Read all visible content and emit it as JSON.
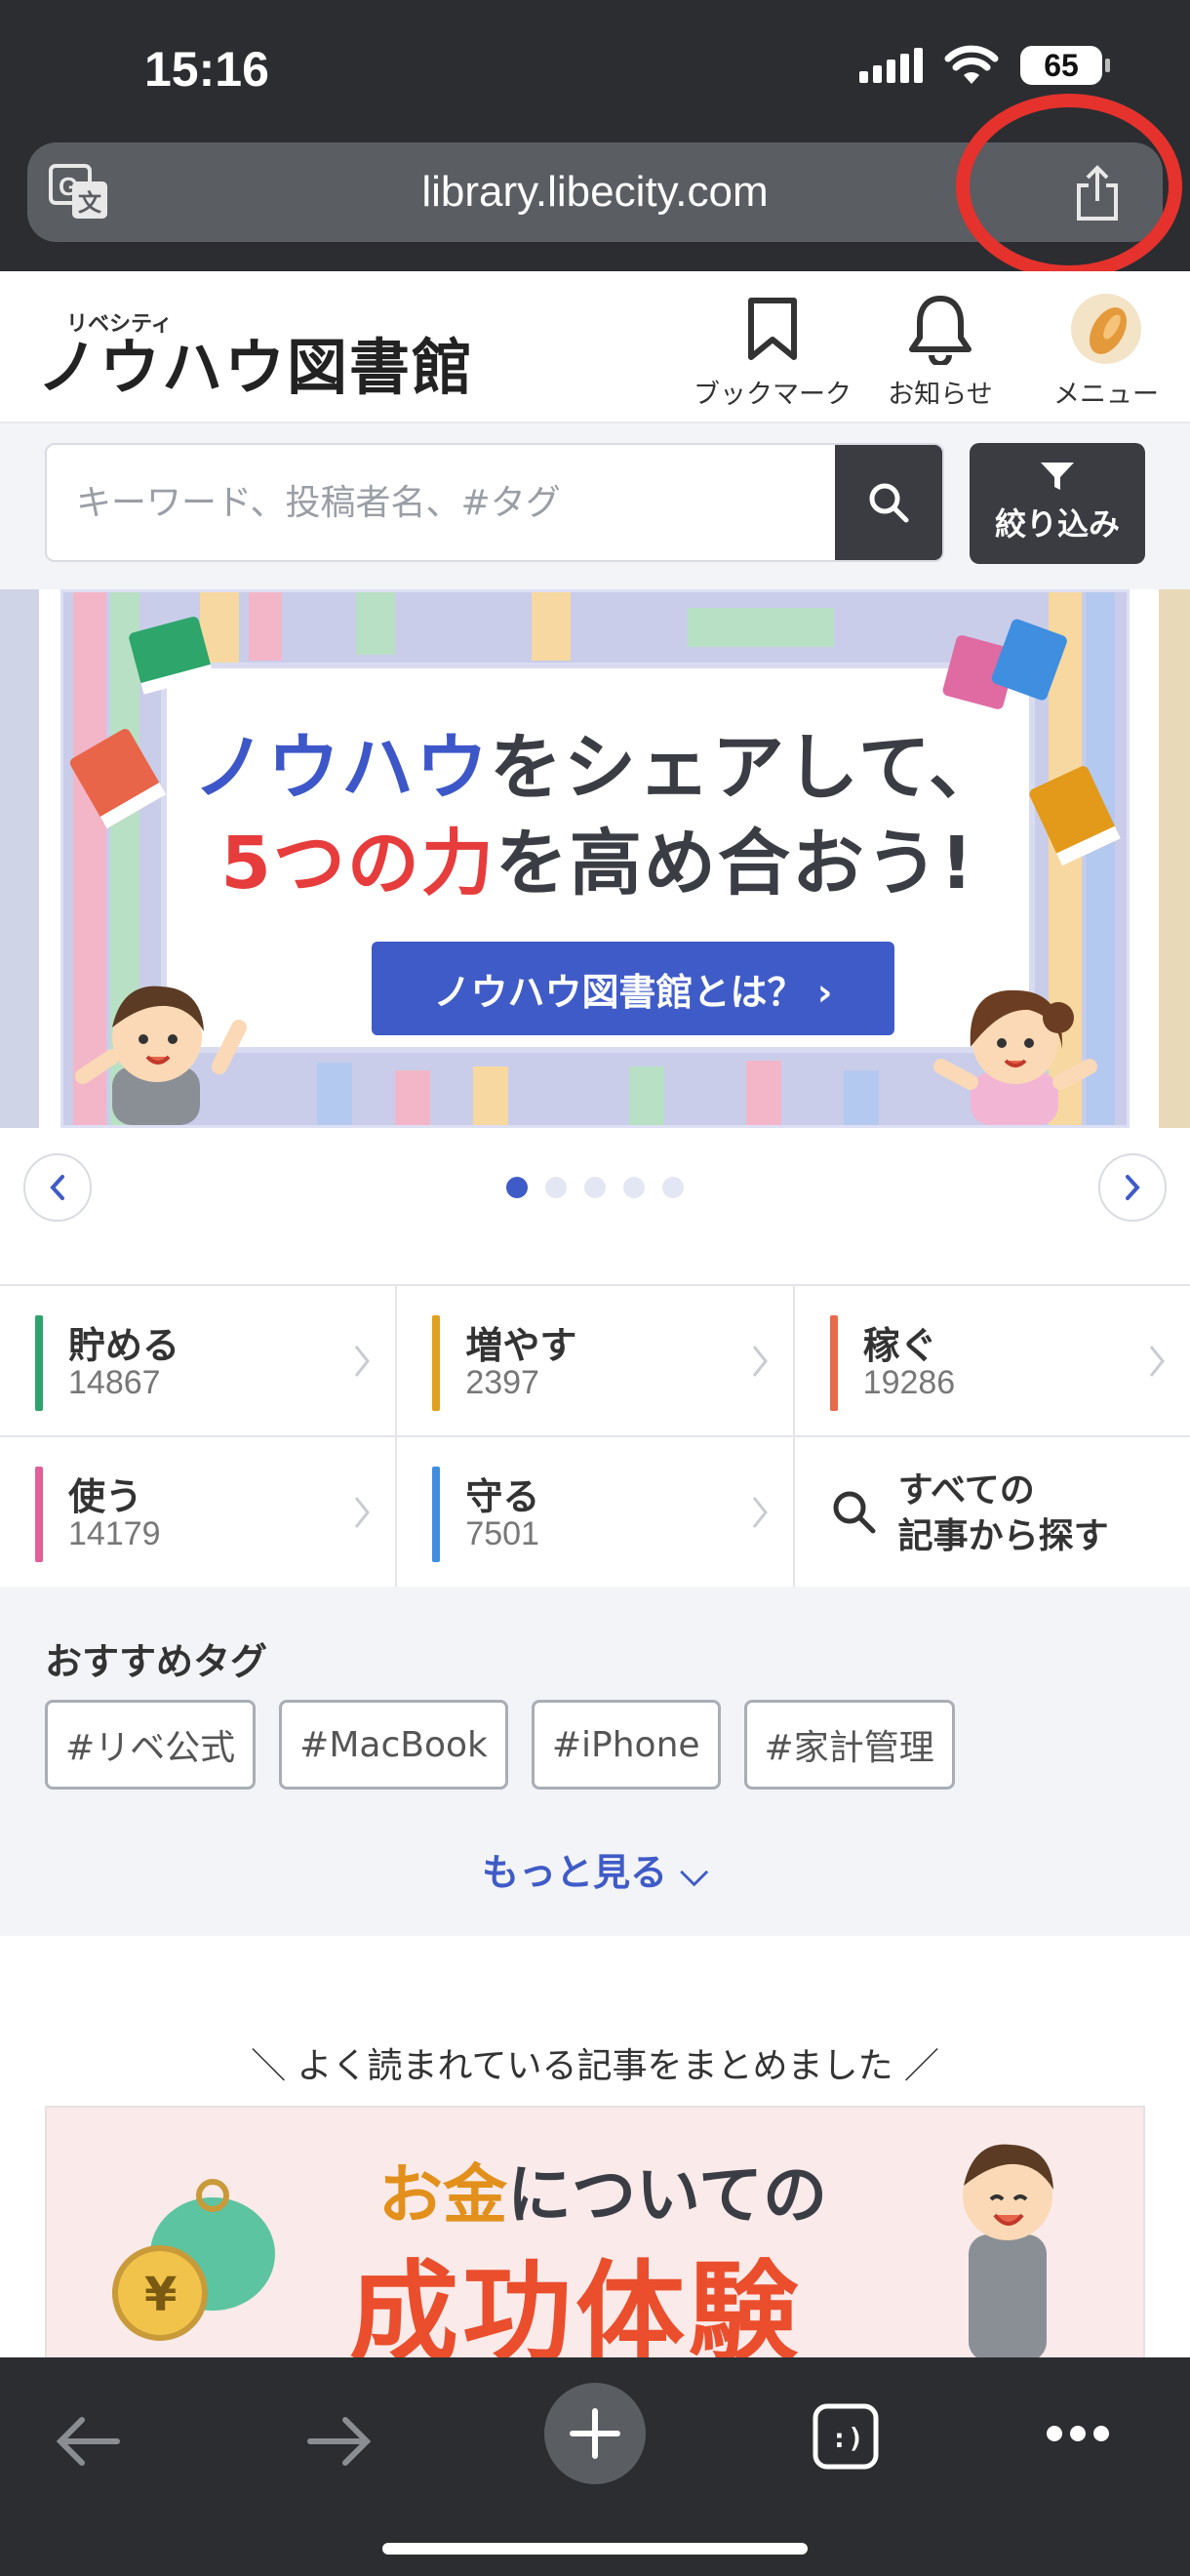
{
  "status_bar": {
    "time": "15:16",
    "battery": "65"
  },
  "browser": {
    "url": "library.libecity.com"
  },
  "site": {
    "logo_small": "リベシティ",
    "logo_main": "ノウハウ図書館",
    "header_buttons": [
      {
        "label": "ブックマーク",
        "icon": "bookmark-icon"
      },
      {
        "label": "お知らせ",
        "icon": "bell-icon"
      },
      {
        "label": "メニュー",
        "icon": "menu-avatar-icon"
      }
    ]
  },
  "search": {
    "placeholder": "キーワード、投稿者名、#タグ",
    "filter_label": "絞り込み"
  },
  "banner": {
    "line1_blue": "ノウハウ",
    "line1_rest": "をシェアして、",
    "line2_red": "5つの力",
    "line2_rest": "を高め合おう!",
    "cta": "ノウハウ図書館とは？ ›",
    "dots": 5,
    "active_dot": 0
  },
  "categories": [
    {
      "name": "貯める",
      "count": "14867",
      "color": "#2fa36b"
    },
    {
      "name": "増やす",
      "count": "2397",
      "color": "#e0a020"
    },
    {
      "name": "稼ぐ",
      "count": "19286",
      "color": "#e86a4a"
    },
    {
      "name": "使う",
      "count": "14179",
      "color": "#e0609a"
    },
    {
      "name": "守る",
      "count": "7501",
      "color": "#3f8ee0"
    }
  ],
  "category_search": {
    "line1": "すべての",
    "line2": "記事から探す"
  },
  "tags": {
    "title": "おすすめタグ",
    "items": [
      "#リベ公式",
      "#MacBook",
      "#iPhone",
      "#家計管理"
    ],
    "more": "もっと見る ⌵"
  },
  "popular": {
    "heading": "＼ よく読まれている記事をまとめました ／",
    "banner_line1_a": "お金",
    "banner_line1_b": "についての",
    "banner_line2": "成功体験"
  },
  "colors": {
    "accent": "#3f5bc7",
    "chrome": "#2b2d31",
    "highlight": "#e5322d"
  }
}
